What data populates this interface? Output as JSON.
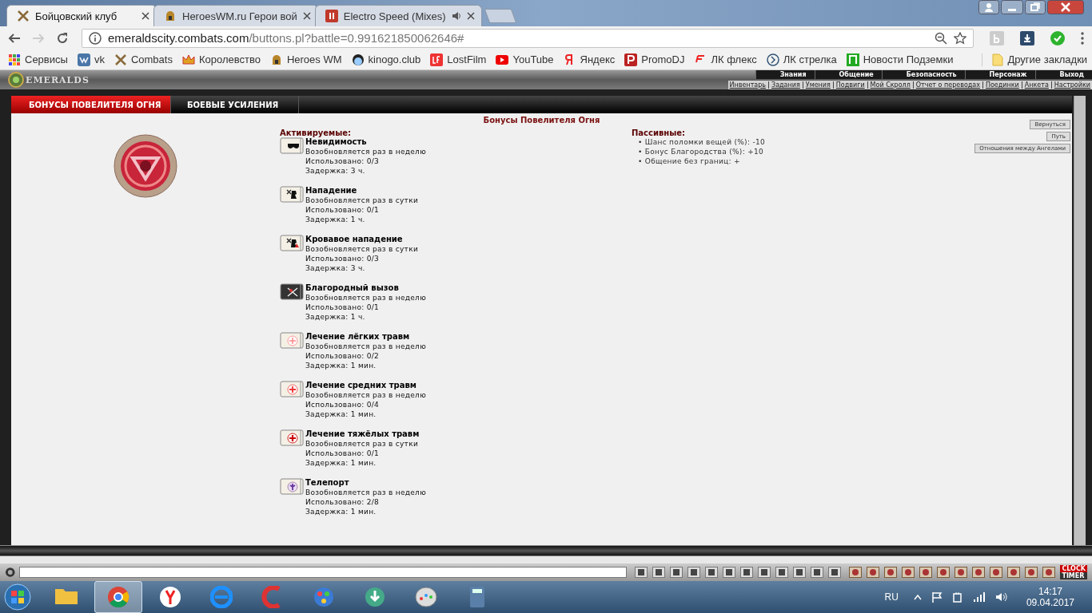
{
  "browser": {
    "tabs": [
      {
        "title": "Бойцовский клуб",
        "selected": true,
        "kind": "swords",
        "audio": false
      },
      {
        "title": "HeroesWM.ru Герои вой",
        "selected": false,
        "kind": "helmet",
        "audio": false
      },
      {
        "title": "Electro Speed (Mixes)",
        "selected": false,
        "kind": "pause",
        "audio": true
      }
    ],
    "address": {
      "host": "emeraldscity.combats.com",
      "path": "/buttons.pl?battle=0.991621850062646#"
    },
    "bookmarks": [
      {
        "title": "Сервисы",
        "kind": "apps"
      },
      {
        "title": "vk",
        "kind": "vk"
      },
      {
        "title": "Combats",
        "kind": "swords"
      },
      {
        "title": "Королевство",
        "kind": "crown"
      },
      {
        "title": "Heroes WM",
        "kind": "helmet"
      },
      {
        "title": "kinogo.club",
        "kind": "face"
      },
      {
        "title": "LostFilm",
        "kind": "lf"
      },
      {
        "title": "YouTube",
        "kind": "play"
      },
      {
        "title": "Яндекс",
        "kind": "ya"
      },
      {
        "title": "PromoDJ",
        "kind": "p"
      },
      {
        "title": "ЛК флекс",
        "kind": "flex"
      },
      {
        "title": "ЛК стрелка",
        "kind": "arrow"
      },
      {
        "title": "Новости Подземки",
        "kind": "metro"
      }
    ],
    "other_bookmarks": "Другие закладки"
  },
  "game": {
    "logo": "EMERALDS",
    "top_menu": [
      "Знания",
      "Общение",
      "Безопасность",
      "Персонаж",
      "Выход"
    ],
    "sub_menu": [
      "Инвентарь",
      "Задания",
      "Умения",
      "Подвиги",
      "Мой Скролл",
      "Отчет о переводах",
      "Поединки",
      "Анкета",
      "Настройки"
    ],
    "tabs": [
      {
        "label": "БОНУСЫ ПОВЕЛИТЕЛЯ ОГНЯ",
        "selected": true
      },
      {
        "label": "БОЕВЫЕ УСИЛЕНИЯ",
        "selected": false
      }
    ],
    "heading": "Бонусы Повелителя Огня",
    "activatable": {
      "title": "Активируемые:",
      "items": [
        {
          "name": "Невидимость",
          "kind": "glasses",
          "renew": "Возобновляется раз в неделю",
          "used": "Использовано: 0/3",
          "delay": "Задержка: 3 ч."
        },
        {
          "name": "Нападение",
          "kind": "attack",
          "renew": "Возобновляется раз в сутки",
          "used": "Использовано: 0/1",
          "delay": "Задержка: 1 ч."
        },
        {
          "name": "Кровавое нападение",
          "kind": "bloody",
          "renew": "Возобновляется раз в сутки",
          "used": "Использовано: 0/3",
          "delay": "Задержка: 3 ч."
        },
        {
          "name": "Благородный вызов",
          "kind": "challenge",
          "renew": "Возобновляется раз в неделю",
          "used": "Использовано: 0/1",
          "delay": "Задержка: 1 ч."
        },
        {
          "name": "Лечение лёгких травм",
          "kind": "heal_light",
          "renew": "Возобновляется раз в неделю",
          "used": "Использовано: 0/2",
          "delay": "Задержка: 1 мин."
        },
        {
          "name": "Лечение средних травм",
          "kind": "heal_medium",
          "renew": "Возобновляется раз в неделю",
          "used": "Использовано: 0/4",
          "delay": "Задержка: 1 мин."
        },
        {
          "name": "Лечение тяжёлых травм",
          "kind": "heal_heavy",
          "renew": "Возобновляется раз в сутки",
          "used": "Использовано: 0/1",
          "delay": "Задержка: 1 мин."
        },
        {
          "name": "Телепорт",
          "kind": "teleport",
          "renew": "Возобновляется раз в неделю",
          "used": "Использовано: 2/8",
          "delay": "Задержка: 1 мин."
        }
      ]
    },
    "passive": {
      "title": "Пассивные:",
      "items": [
        "• Шанс поломки вещей (%): -10",
        "• Бонус Благородства (%): +10",
        "• Общение без границ: +"
      ]
    },
    "buttons": [
      "Вернуться",
      "Путь",
      "Отношения между Ангелами"
    ],
    "clock": "CLOCK",
    "timer": "TIMER"
  },
  "taskbar": {
    "apps": [
      {
        "kind": "explorer",
        "selected": false
      },
      {
        "kind": "chrome",
        "selected": true
      },
      {
        "kind": "yandex",
        "selected": false
      },
      {
        "kind": "ie",
        "selected": false
      },
      {
        "kind": "ccleaner",
        "selected": false
      },
      {
        "kind": "paint3d",
        "selected": false
      },
      {
        "kind": "download",
        "selected": false
      },
      {
        "kind": "paint",
        "selected": false
      },
      {
        "kind": "calculator",
        "selected": false
      }
    ],
    "language": "RU",
    "time": "14:17",
    "date": "09.04.2017"
  }
}
